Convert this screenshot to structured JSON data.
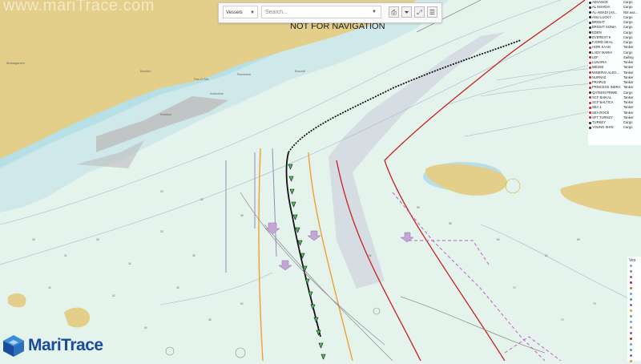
{
  "watermark": "www.mariTrace.com",
  "notice": "NOT FOR NAVIGATION",
  "toolbar": {
    "select_value": "Vessels",
    "search_placeholder": "Search..."
  },
  "vessels": [
    {
      "name": "ADVANCE",
      "type": "Cargo",
      "extra": "",
      "color": "#222222"
    },
    {
      "name": "AL MAHDIA",
      "type": "Cargo",
      "extra": "",
      "color": "#222222"
    },
    {
      "name": "AL-AMADI (AS...",
      "type": "Not ava...",
      "extra": "",
      "color": "#222222"
    },
    {
      "name": "ANU LUCKY",
      "type": "Cargo",
      "extra": "",
      "color": "#222222"
    },
    {
      "name": "BRIGHT",
      "type": "Cargo",
      "extra": "",
      "color": "#222222"
    },
    {
      "name": "BRIGHT SONIA",
      "type": "Cargo",
      "extra": "",
      "color": "#222222"
    },
    {
      "name": "EDEN",
      "type": "Cargo",
      "extra": "",
      "color": "#222222"
    },
    {
      "name": "EVEREST K",
      "type": "Cargo",
      "extra": "",
      "color": "#222222"
    },
    {
      "name": "FJORD SEAL",
      "type": "Cargo",
      "extra": "",
      "color": "#222222"
    },
    {
      "name": "HORI KAAN",
      "type": "Tanker",
      "extra": "",
      "color": "#cc2222"
    },
    {
      "name": "LADY MARIA",
      "type": "Cargo",
      "extra": "",
      "color": "#222222"
    },
    {
      "name": "LEF",
      "type": "Sailing",
      "extra": "",
      "color": "#cc2222"
    },
    {
      "name": "LUNARIA",
      "type": "Tanker",
      "extra": "",
      "color": "#cc2222"
    },
    {
      "name": "MESINI",
      "type": "Tanker",
      "extra": "",
      "color": "#cc2222"
    },
    {
      "name": "MINERVA ALEG...",
      "type": "Tanker",
      "extra": "",
      "color": "#cc2222"
    },
    {
      "name": "NURNAZ",
      "type": "Tanker",
      "extra": "",
      "color": "#cc2222"
    },
    {
      "name": "PRAPUS",
      "type": "Tanker",
      "extra": "",
      "color": "#cc2222"
    },
    {
      "name": "PRINCESS INDRA",
      "type": "Tanker",
      "extra": "",
      "color": "#cc2222"
    },
    {
      "name": "QATEEN PRIME",
      "type": "Cargo",
      "extra": "",
      "color": "#222222"
    },
    {
      "name": "SCF BAIKAL",
      "type": "Tanker",
      "extra": "",
      "color": "#cc2222"
    },
    {
      "name": "SCF BALTICA",
      "type": "Tanker",
      "extra": "",
      "color": "#cc2222"
    },
    {
      "name": "SEA 1",
      "type": "Tanker",
      "extra": "",
      "color": "#cc2222"
    },
    {
      "name": "SEA ROCK",
      "type": "Tanker",
      "extra": "",
      "color": "#cc2222"
    },
    {
      "name": "SFT TURKEY",
      "type": "Tanker",
      "extra": "",
      "color": "#cc2222"
    },
    {
      "name": "TURKEY",
      "type": "Cargo",
      "extra": "",
      "color": "#222222"
    },
    {
      "name": "YOUNG SHIN",
      "type": "Cargo",
      "extra": "",
      "color": "#222222"
    }
  ],
  "legend": {
    "title": "Ves",
    "colors": [
      "#7aa0d8",
      "#8a8a8a",
      "#b84d8a",
      "#cc2222",
      "#c07040",
      "#6fa0d0",
      "#40a090",
      "#8060c0",
      "#d0a030",
      "#60b060",
      "#7aa0d8",
      "#a0a0a0",
      "#b84d8a",
      "#cc2222",
      "#6fa0d0",
      "#40a090",
      "#8060c0",
      "#d0a030"
    ]
  },
  "logo": {
    "text": "MariTrace"
  },
  "places": [
    "Boulder",
    "Ras El Ma",
    "Roustane",
    "Bouzidi",
    "Mostaganem",
    "Antouche",
    "Keddau"
  ]
}
